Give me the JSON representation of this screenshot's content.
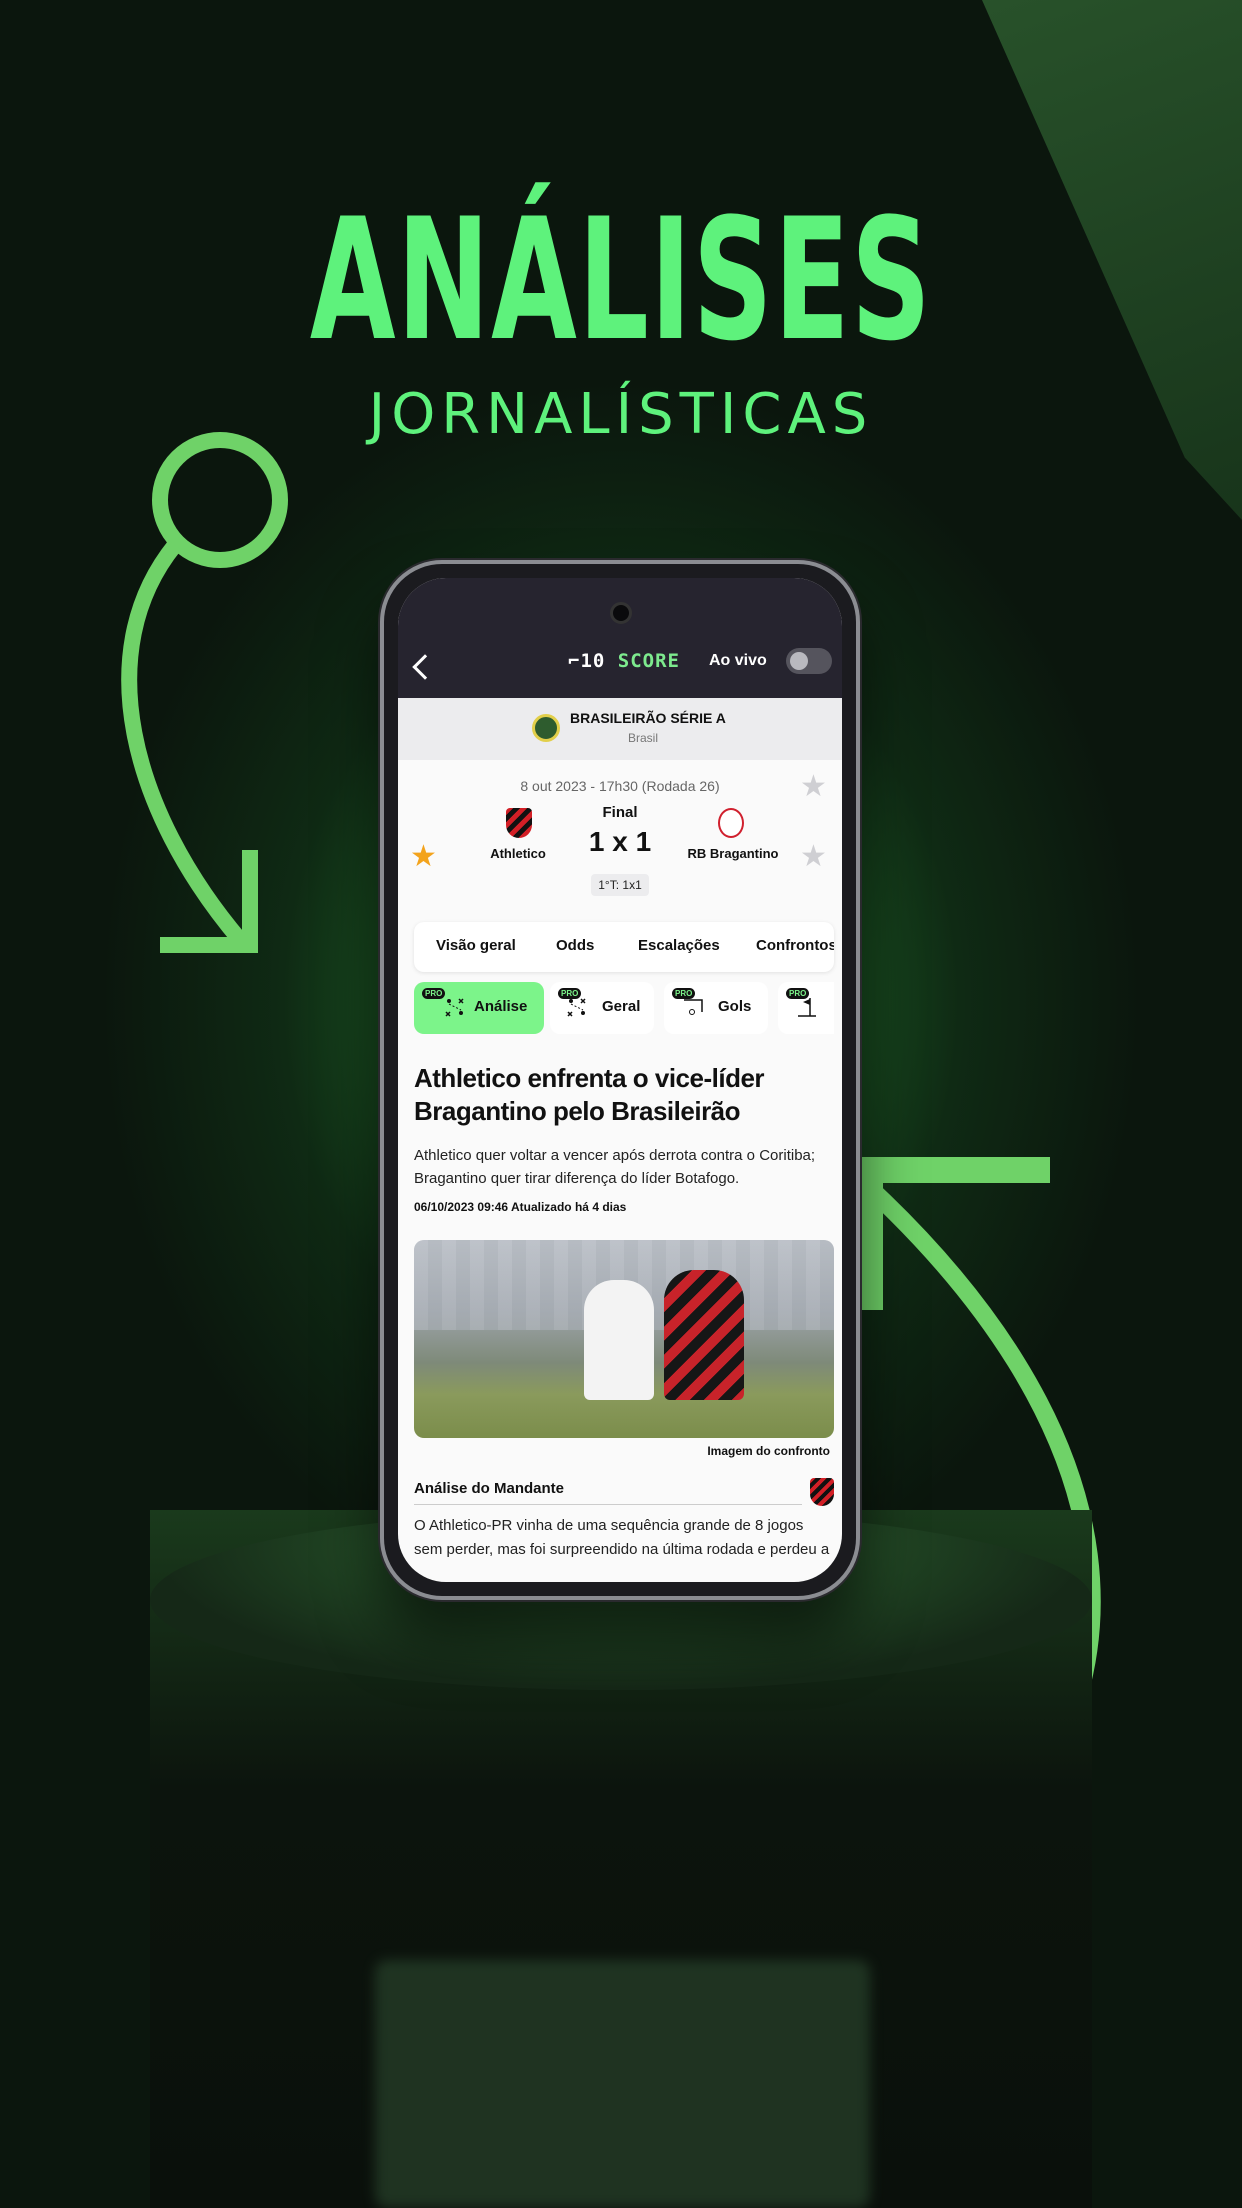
{
  "hero": {
    "title": "ANÁLISES",
    "subtitle": "JORNALÍSTICAS"
  },
  "app": {
    "logo_prefix": "⌐10",
    "logo_suffix": "SCORE",
    "live_label": "Ao vivo"
  },
  "league": {
    "name": "BRASILEIRÃO SÉRIE A",
    "country": "Brasil"
  },
  "match": {
    "date": "8 out 2023 - 17h30 (Rodada 26)",
    "status": "Final",
    "score": "1 x 1",
    "halftime": "1°T: 1x1",
    "home": "Athletico",
    "away": "RB Bragantino"
  },
  "tabs": [
    "Visão geral",
    "Odds",
    "Escalações",
    "Confrontos"
  ],
  "subtabs": [
    {
      "badge": "PRO",
      "label": "Análise"
    },
    {
      "badge": "PRO",
      "label": "Geral"
    },
    {
      "badge": "PRO",
      "label": "Gols"
    },
    {
      "badge": "PRO",
      "label": ""
    }
  ],
  "article": {
    "title": "Athletico enfrenta o vice-líder Bragantino pelo Brasileirão",
    "lead": "Athletico quer voltar a vencer após derrota contra o Coritiba; Bragantino quer tirar diferença do líder Botafogo.",
    "meta": "06/10/2023 09:46 Atualizado há 4 dias",
    "image_caption": "Imagem do confronto",
    "section_title": "Análise do Mandante",
    "section_body": "O Athletico-PR vinha de uma sequência grande de 8 jogos sem perder, mas foi surpreendido na última rodada e perdeu a"
  },
  "colors": {
    "accent": "#5ef27c",
    "appbar": "#26242f",
    "active_tab": "#7cf48a",
    "star_fav": "#f3a31c"
  }
}
